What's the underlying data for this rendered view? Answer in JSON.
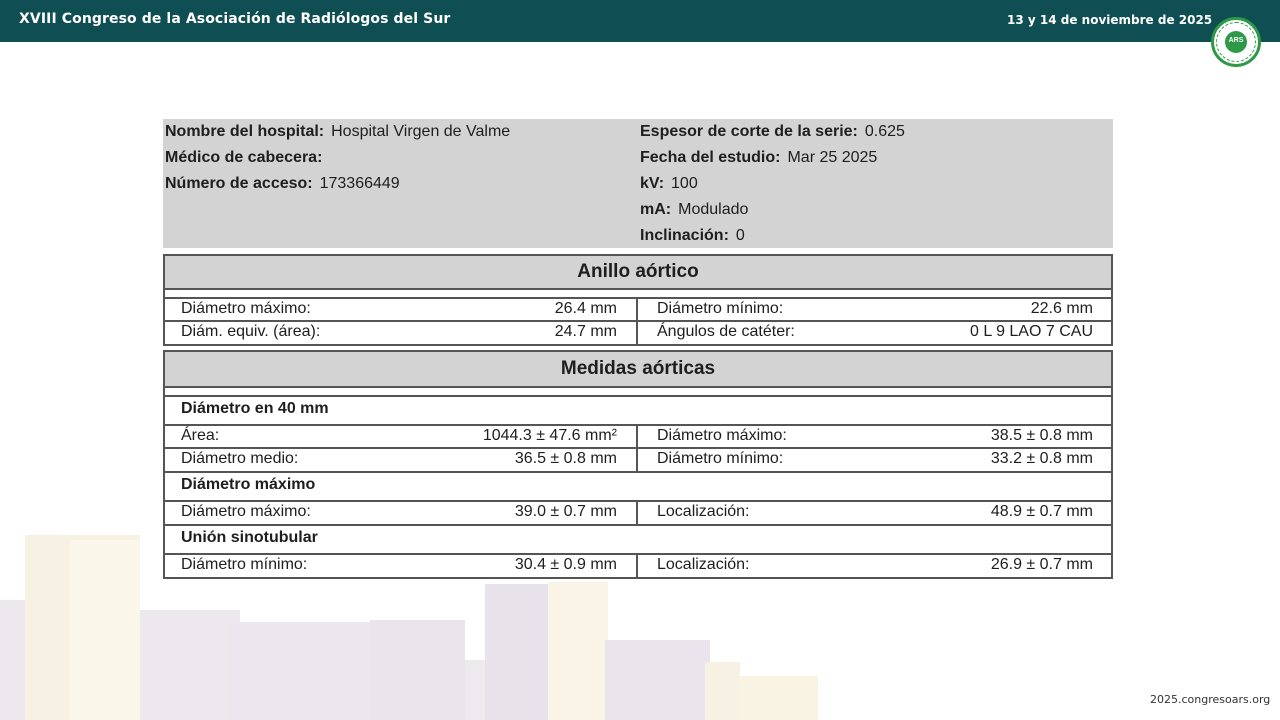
{
  "header": {
    "title": "XVIII Congreso de la Asociación de Radiólogos del Sur",
    "date": "13 y 14 de noviembre de 2025",
    "logo_text": "ARS"
  },
  "footer": {
    "url": "2025.congresoars.org"
  },
  "report": {
    "info_left": [
      {
        "label": "Nombre del hospital:",
        "value": "Hospital Virgen de Valme"
      },
      {
        "label": "Médico de cabecera:",
        "value": ""
      },
      {
        "label": "Número de acceso:",
        "value": "173366449"
      }
    ],
    "info_right": [
      {
        "label": "Espesor de corte de la serie:",
        "value": "0.625"
      },
      {
        "label": "Fecha del estudio:",
        "value": "Mar 25 2025"
      },
      {
        "label": "kV:",
        "value": "100"
      },
      {
        "label": "mA:",
        "value": "Modulado"
      },
      {
        "label": "Inclinación:",
        "value": "0"
      }
    ],
    "anillo": {
      "title": "Anillo aórtico",
      "rows": [
        {
          "l_label": "Diámetro máximo:",
          "l_value": "26.4 mm",
          "r_label": "Diámetro mínimo:",
          "r_value": "22.6 mm"
        },
        {
          "l_label": "Diám. equiv. (área):",
          "l_value": "24.7 mm",
          "r_label": "Ángulos de catéter:",
          "r_value": "0 L 9 LAO 7 CAU"
        }
      ]
    },
    "medidas": {
      "title": "Medidas aórticas",
      "diam40": {
        "title": "Diámetro en 40 mm",
        "rows": [
          {
            "l_label": "Área:",
            "l_value": "1044.3 ± 47.6 mm²",
            "r_label": "Diámetro máximo:",
            "r_value": "38.5 ± 0.8 mm"
          },
          {
            "l_label": "Diámetro medio:",
            "l_value": "36.5 ± 0.8 mm",
            "r_label": "Diámetro mínimo:",
            "r_value": "33.2 ± 0.8 mm"
          }
        ]
      },
      "diammax": {
        "title": "Diámetro máximo",
        "row": {
          "l_label": "Diámetro máximo:",
          "l_value": "39.0 ± 0.7 mm",
          "r_label": "Localización:",
          "r_value": "48.9 ± 0.7 mm"
        }
      },
      "sino": {
        "title": "Unión sinotubular",
        "row": {
          "l_label": "Diámetro mínimo:",
          "l_value": "30.4 ± 0.9 mm",
          "r_label": "Localización:",
          "r_value": "26.9 ± 0.7 mm"
        }
      }
    }
  }
}
